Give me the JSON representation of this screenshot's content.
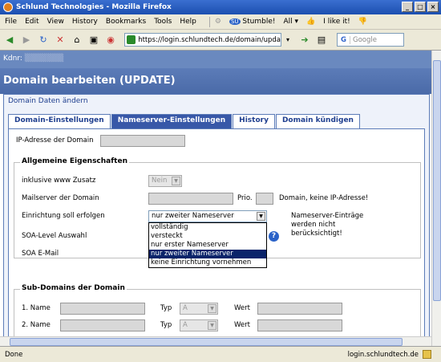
{
  "window": {
    "title": "Schlund Technologies - Mozilla Firefox"
  },
  "menu": [
    "File",
    "Edit",
    "View",
    "History",
    "Bookmarks",
    "Tools",
    "Help"
  ],
  "menu_extra": {
    "stumble": "Stumble!",
    "all": "All",
    "ilike": "I like it!"
  },
  "toolbar": {
    "url": "https://login.schlundtech.de/domain/upda",
    "search_placeholder": "Google"
  },
  "page": {
    "kdnr_label": "Kdnr:",
    "title": "Domain bearbeiten (UPDATE)",
    "panel_title": "Domain Daten ändern",
    "tabs": [
      {
        "label": "Domain-Einstellungen"
      },
      {
        "label": "Nameserver-Einstellungen"
      },
      {
        "label": "History"
      },
      {
        "label": "Domain kündigen"
      }
    ],
    "ip_label": "IP-Adresse der Domain",
    "general": {
      "legend": "Allgemeine Eigenschaften",
      "www_label": "inklusive www Zusatz",
      "www_value": "Nein",
      "mail_label": "Mailserver der Domain",
      "prio_label": "Prio.",
      "mail_note": "Domain, keine IP-Adresse!",
      "setup_label": "Einrichtung soll erfolgen",
      "setup_value": "nur zweiter Nameserver",
      "setup_note": "Nameserver-Einträge werden nicht berücksichtigt!",
      "soa_level_label": "SOA-Level Auswahl",
      "soa_email_label": "SOA E-Mail",
      "options": [
        "vollständig",
        "versteckt",
        "nur erster Nameserver",
        "nur zweiter Nameserver",
        "keine Einrichtung vornehmen"
      ],
      "selected_option": "nur zweiter Nameserver"
    },
    "subdomains": {
      "legend": "Sub-Domains der Domain",
      "rows": [
        {
          "name_label": "1. Name",
          "type_label": "Typ",
          "type_value": "A",
          "value_label": "Wert"
        },
        {
          "name_label": "2. Name",
          "type_label": "Typ",
          "type_value": "A",
          "value_label": "Wert"
        }
      ]
    }
  },
  "status": {
    "left": "Done",
    "right": "login.schlundtech.de"
  }
}
